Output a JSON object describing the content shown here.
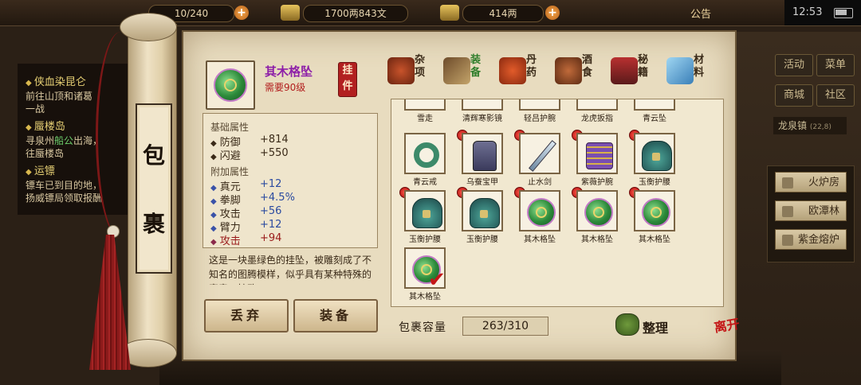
{
  "hud": {
    "bag_fraction": "10/240",
    "money": "1700两843文",
    "gold": "414两",
    "notice": "公告",
    "time": "12:53"
  },
  "quests": {
    "line1_title": "侠血染昆仑",
    "line1_desc": "前往山顶和诸葛",
    "line1_desc2": "一战",
    "line2_title": "蜃楼岛",
    "line2_desc_a": "寻泉州",
    "line2_desc_npc": "船公",
    "line2_desc_b": "出海，",
    "line2_desc2": "往蜃楼岛",
    "line3_title": "运镖",
    "line3_desc": "镖车已到目的地，",
    "line3_desc2": "扬威镖局领取报酬"
  },
  "side_menu": {
    "activity": "活动",
    "menu": "菜单",
    "mall": "商城",
    "community": "社区",
    "location": "龙泉镇",
    "coords": "(22,8)",
    "facilities": [
      "火炉房",
      "欧潭林",
      "紫金熔炉"
    ]
  },
  "scroll": {
    "title_chars": [
      "包",
      "裹"
    ]
  },
  "item": {
    "name": "其木格坠",
    "requirement": "需要90级",
    "hang_label": "挂件",
    "base_title": "基础属性",
    "base_attrs": [
      {
        "name": "防御",
        "value": "+814"
      },
      {
        "name": "闪避",
        "value": "+550"
      }
    ],
    "extra_title": "附加属性",
    "extra_attrs": [
      {
        "name": "真元",
        "value": "+12"
      },
      {
        "name": "拳脚",
        "value": "+4.5%"
      },
      {
        "name": "攻击",
        "value": "+56"
      },
      {
        "name": "臂力",
        "value": "+12"
      },
      {
        "name": "攻击",
        "value": "+94"
      }
    ],
    "description": "这是一块墨绿色的挂坠，被雕刻成了不知名的图腾模样，似乎具有某种特殊的寓意，挂欧"
  },
  "categories": [
    {
      "label": "杂项"
    },
    {
      "label": "装备"
    },
    {
      "label": "丹药"
    },
    {
      "label": "酒食"
    },
    {
      "label": "秘籍"
    },
    {
      "label": "材料"
    }
  ],
  "actions": {
    "discard": "丢弃",
    "equip": "装备"
  },
  "grid": {
    "top_row": [
      "雪走",
      "清辉寒影镜",
      "轻吕护腕",
      "龙虎扳指",
      "青云坠"
    ],
    "row1": [
      "青云戒",
      "乌蚕宝甲",
      "止水剑",
      "紫薇护腕",
      "玉衡护腰"
    ],
    "row2": [
      "玉衡护腰",
      "玉衡护腰",
      "其木格坠",
      "其木格坠",
      "其木格坠"
    ],
    "row3": [
      "其木格坠"
    ]
  },
  "capacity": {
    "label": "包裹容量",
    "value": "263/310"
  },
  "sort_label": "整理",
  "leave_label": "离开"
}
